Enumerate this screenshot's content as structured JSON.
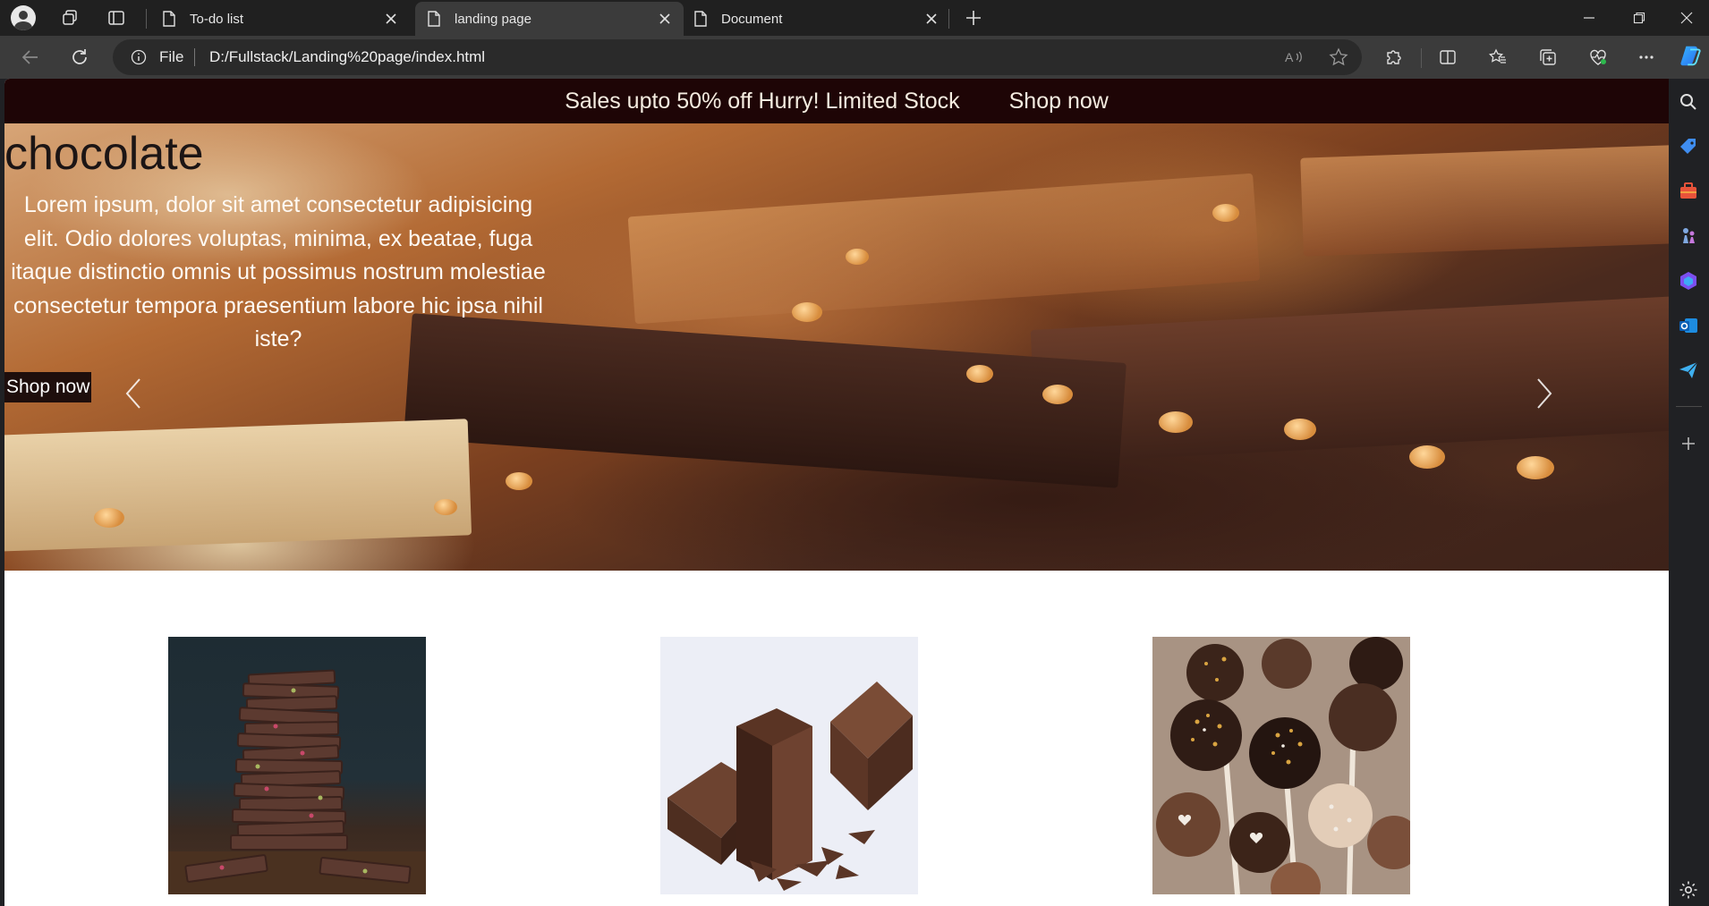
{
  "browser": {
    "tabs": [
      {
        "title": "To-do list",
        "active": false
      },
      {
        "title": "landing page",
        "active": true
      },
      {
        "title": "Document",
        "active": false
      }
    ],
    "address": {
      "scheme_label": "File",
      "url": "D:/Fullstack/Landing%20page/index.html"
    },
    "icons": {
      "profile": "profile-avatar-icon",
      "workspaces": "workspaces-icon",
      "vertical_tabs": "vertical-tabs-icon",
      "new_tab": "plus-icon",
      "back": "arrow-left-icon",
      "reload": "reload-icon",
      "read_aloud": "read-aloud-icon",
      "favorite": "star-icon",
      "extensions": "puzzle-icon",
      "split_screen": "split-screen-icon",
      "favorites": "favorites-icon",
      "collections": "collections-icon",
      "performance": "heart-pulse-icon",
      "more": "ellipsis-icon",
      "copilot": "copilot-icon"
    },
    "sidebar_icons": [
      "search-icon",
      "shopping-tag-icon",
      "briefcase-icon",
      "chess-icon",
      "m365-icon",
      "outlook-icon",
      "send-icon",
      "plus-icon",
      "gear-icon"
    ]
  },
  "page": {
    "promo": {
      "text": "Sales upto 50% off Hurry! Limited Stock",
      "link": "Shop now"
    },
    "hero": {
      "title": "chocolate",
      "description": "Lorem ipsum, dolor sit amet consectetur adipisicing elit. Odio dolores voluptas, minima, ex beatae, fuga itaque distinctio omnis ut possimus nostrum molestiae consectetur tempora praesentium labore hic ipsa nihil iste?",
      "button": "Shop now"
    },
    "products": [
      {
        "name": "chocolate-bar-stack-image"
      },
      {
        "name": "chocolate-blocks-image"
      },
      {
        "name": "cake-pops-image"
      }
    ]
  }
}
